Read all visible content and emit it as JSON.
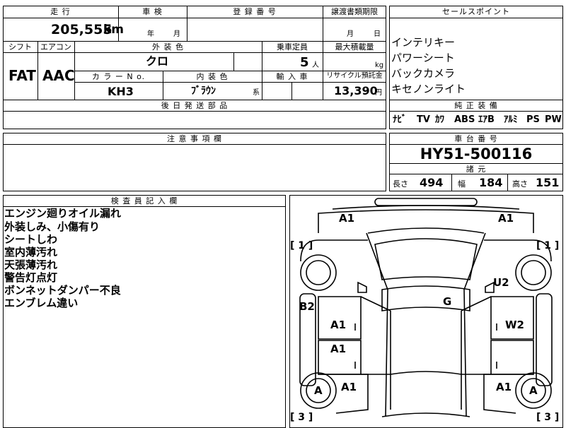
{
  "top_row": {
    "mileage_label": "走 行",
    "inspection_label": "車 検",
    "registration_label": "登 録 番 号",
    "transfer_docs_label": "譲渡書類期限",
    "mileage_value": "205,555",
    "mileage_unit": "km",
    "year_unit": "年",
    "month_unit": "月",
    "transfer_month_unit": "月",
    "transfer_day_unit": "日"
  },
  "spec_row": {
    "shift_label": "シフト",
    "ac_label": "エアコン",
    "exterior_color_label": "外 装 色",
    "seating_label": "乗車定員",
    "max_load_label": "最大積載量",
    "shift_value": "FAT",
    "ac_value": "AAC",
    "exterior_color_value": "クロ",
    "seating_value": "5",
    "seating_unit": "人",
    "load_unit": "kg",
    "color_no_label": "カ ラ ー N o.",
    "interior_color_label": "内 装 色",
    "import_label": "輸 入 車",
    "recycle_label": "リサイクル預託金",
    "color_no_value": "KH3",
    "interior_color_value": "ﾌﾞﾗｳﾝ",
    "interior_color_suffix": "系",
    "recycle_value": "13,390",
    "recycle_unit": "円",
    "later_parts_label": "後 日 発 送 部 品"
  },
  "sales_points": {
    "header": "セールスポイント",
    "items": [
      "インテリキー",
      "パワーシート",
      "バックカメラ",
      "キセノンライト"
    ]
  },
  "equipment": {
    "header": "純 正 装 備",
    "items": [
      "ﾅﾋﾞ",
      "TV",
      "ｶﾜ",
      "ABS",
      "ｴｱB",
      "ｱﾙﾐ",
      "PS",
      "PW"
    ]
  },
  "notes": {
    "header": "注 意 事 項 欄"
  },
  "chassis": {
    "header": "車 台 番 号",
    "value": "HY51-500116"
  },
  "dimensions": {
    "header": "諸 元",
    "length_label": "長さ",
    "length_value": "494",
    "width_label": "幅",
    "width_value": "184",
    "height_label": "高さ",
    "height_value": "151"
  },
  "inspector": {
    "header": "検 査 員 記 入 欄",
    "items": [
      "エンジン廻りオイル漏れ",
      "外装しみ、小傷有り",
      "シートしわ",
      "室内薄汚れ",
      "天張薄汚れ",
      "警告灯点灯",
      "ボンネットダンパー不良",
      "エンブレム違い"
    ]
  },
  "diagram": {
    "marks": {
      "front_left": "A1",
      "front_right": "A1",
      "left_front_bracket": "[ 1 ]",
      "right_front_bracket": "[ 1 ]",
      "u2": "U2",
      "roof": "G",
      "b2": "B2",
      "left_door_front": "A1",
      "right_door_front": "W2",
      "left_door_rear": "A1",
      "left_rear": "A1",
      "right_rear": "A1",
      "left_wheel": "A",
      "right_wheel": "A",
      "left_rear_bracket": "[ 3 ]",
      "right_rear_bracket": "[ 3 ]"
    }
  }
}
